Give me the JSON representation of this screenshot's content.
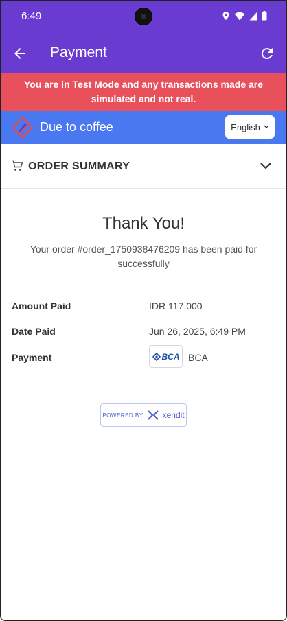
{
  "status_bar": {
    "time": "6:49"
  },
  "app_bar": {
    "title": "Payment"
  },
  "test_banner": {
    "text": "You are in Test Mode and any transactions made are simulated and not real."
  },
  "merchant": {
    "name": "Due to coffee",
    "language": "English"
  },
  "order_summary": {
    "title": "ORDER SUMMARY"
  },
  "thank_you": {
    "title": "Thank You!",
    "message": "Your order #order_1750938476209 has been paid for successfully"
  },
  "details": {
    "amount_label": "Amount Paid",
    "amount_value": "IDR 117.000",
    "date_label": "Date Paid",
    "date_value": "Jun 26, 2025, 6:49 PM",
    "payment_label": "Payment",
    "bank_logo_text": "BCA",
    "payment_value": "BCA"
  },
  "footer": {
    "powered_by": "POWERED BY",
    "brand": "xendit"
  },
  "colors": {
    "header": "#6a3bd0",
    "banner": "#e8505b",
    "merchant_bar": "#4a78f0",
    "bca_blue": "#1f4fa3"
  }
}
